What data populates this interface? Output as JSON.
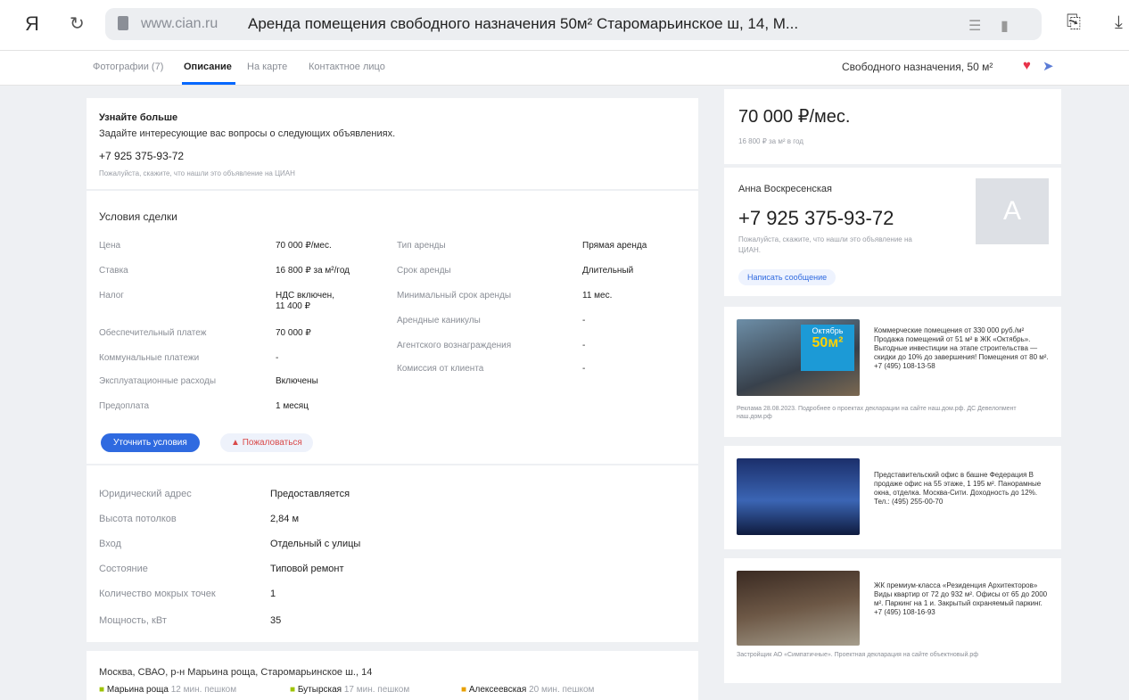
{
  "browser": {
    "yandex_logo": "Я",
    "host": "www.cian.ru",
    "page_title": "Аренда помещения свободного назначения 50м² Старомарьинское ш, 14, М..."
  },
  "tabs": [
    {
      "label": "Фотографии (7)"
    },
    {
      "label": "Описание"
    },
    {
      "label": "На карте"
    },
    {
      "label": "Контактное лицо"
    }
  ],
  "summary": {
    "text": "Свободного назначения, 50 м²"
  },
  "contact_block": {
    "title": "Узнайте больше",
    "subtitle": "Задайте интересующие вас вопросы о следующих объявлениях.",
    "phone": "+7 925 375-93-72",
    "note": "Пожалуйста, скажите, что нашли это объявление на ЦИАН"
  },
  "deal": {
    "title": "Условия сделки",
    "left": [
      {
        "label": "Цена",
        "value": "70 000 ₽/мес."
      },
      {
        "label": "Ставка",
        "value": "16 800 ₽ за м²/год"
      },
      {
        "label": "Налог",
        "value": "НДС включен, 11 400 ₽"
      },
      {
        "label": "Обеспечительный платеж",
        "value": "70 000 ₽"
      },
      {
        "label": "Коммунальные платежи",
        "value": "-"
      },
      {
        "label": "Эксплуатационные расходы",
        "value": "Включены"
      },
      {
        "label": "Предоплата",
        "value": "1 месяц"
      }
    ],
    "right": [
      {
        "label": "Тип аренды",
        "value": "Прямая аренда"
      },
      {
        "label": "Срок аренды",
        "value": "Длительный"
      },
      {
        "label": "Минимальный срок аренды",
        "value": "11 мес."
      },
      {
        "label": "Арендные каникулы",
        "value": "-"
      },
      {
        "label": "Агентского вознаграждения",
        "value": "-"
      },
      {
        "label": "Комиссия от клиента",
        "value": "-"
      }
    ],
    "btn_primary": "Уточнить условия",
    "btn_secondary": "Пожаловаться"
  },
  "attrs": [
    {
      "label": "Юридический адрес",
      "value": "Предоставляется"
    },
    {
      "label": "Высота потолков",
      "value": "2,84 м"
    },
    {
      "label": "Вход",
      "value": "Отдельный с улицы"
    },
    {
      "label": "Состояние",
      "value": "Типовой ремонт"
    },
    {
      "label": "Количество мокрых точек",
      "value": "1"
    },
    {
      "label": "Мощность, кВт",
      "value": "35"
    }
  ],
  "address": {
    "text": "Москва, СВАО, р-н Марьина роща, Старомарьинское ш., 14",
    "metro": [
      {
        "name": "Марьина роща",
        "time": "12 мин. пешком",
        "color": "#9ec400"
      },
      {
        "name": "Бутырская",
        "time": "17 мин. пешком",
        "color": "#9ec400"
      },
      {
        "name": "Алексеевская",
        "time": "20 мин. пешком",
        "color": "#e8a000"
      }
    ]
  },
  "price_card": {
    "price": "70 000 ₽/мес.",
    "sub": "16 800 ₽ за м² в год"
  },
  "agent": {
    "name": "Анна Воскресенская",
    "phone": "+7 925 375-93-72",
    "note1": "Пожалуйста, скажите, что нашли это объявление на",
    "note2": "ЦИАН.",
    "avatar": "A",
    "message_btn": "Написать сообщение"
  },
  "ads": [
    {
      "text": "Коммерческие помещения от 330 000 руб./м² Продажа помещений от 51 м² в ЖК «Октябрь». Выгодные инвестиции на этапе строительства — скидки до 10% до завершения! Помещения от 80 м². +7 (495) 108-13-58",
      "badge_line1": "Октябрь",
      "badge_line2": "50м²",
      "note": "Реклама 28.08.2023. Подробнее о проектах декларации на сайте наш.дом.рф. ДС Девелопмент наш.дом.рф"
    },
    {
      "text": "Представительский офис в башне Федерация В продаже офис на 55 этаже, 1 195 м². Панорамные окна, отделка. Москва-Сити. Доходность до 12%. Тел.: (495) 255-00-70",
      "note": ""
    },
    {
      "text": "ЖК премиум-класса «Резиденция Архитекторов» Виды квартир от 72 до 932 м². Офисы от 65 до 2000 м². Паркинг на 1 и. Закрытый охраняемый паркинг. +7 (495) 108-16-93",
      "note": "Застройщик АО «Симпатичные». Проектная декларация на сайте объектновый.рф"
    }
  ]
}
